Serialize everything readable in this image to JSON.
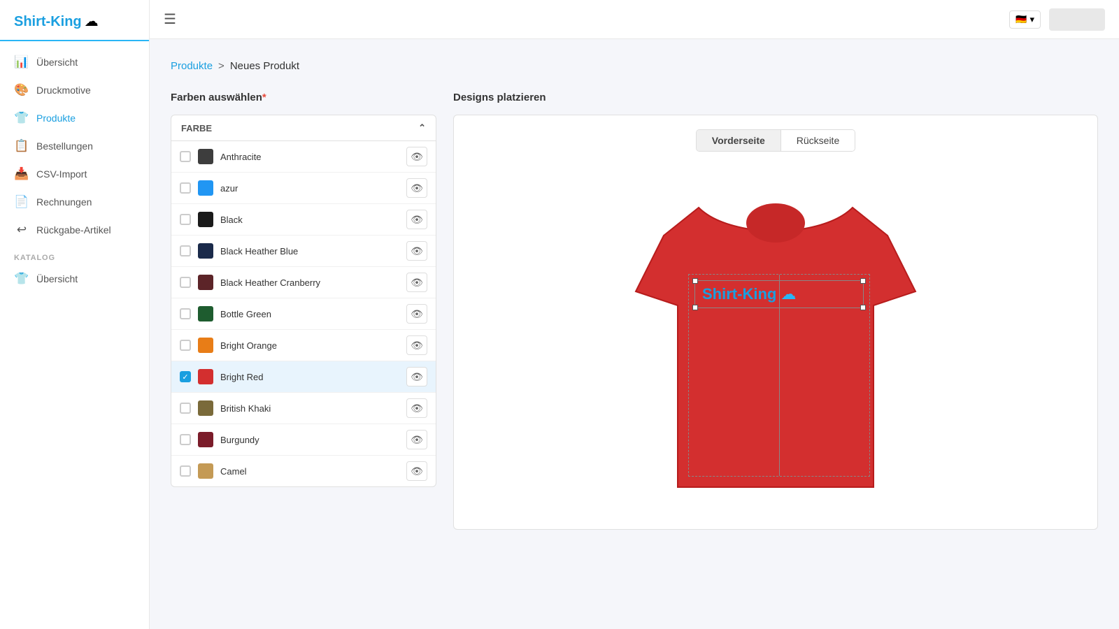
{
  "app": {
    "name": "Shirt-King",
    "logo_icon": "☁"
  },
  "topbar": {
    "hamburger": "☰",
    "flag": "🇩🇪",
    "flag_arrow": "▾"
  },
  "sidebar": {
    "nav_items": [
      {
        "id": "uebersicht",
        "label": "Übersicht",
        "icon": "📊",
        "active": false
      },
      {
        "id": "druckmotive",
        "label": "Druckmotive",
        "icon": "🎨",
        "active": false
      },
      {
        "id": "produkte",
        "label": "Produkte",
        "icon": "👕",
        "active": true
      },
      {
        "id": "bestellungen",
        "label": "Bestellungen",
        "icon": "📋",
        "active": false
      },
      {
        "id": "csv-import",
        "label": "CSV-Import",
        "icon": "📥",
        "active": false
      },
      {
        "id": "rechnungen",
        "label": "Rechnungen",
        "icon": "📄",
        "active": false
      },
      {
        "id": "rueckgabe",
        "label": "Rückgabe-Artikel",
        "icon": "↩",
        "active": false
      }
    ],
    "katalog_label": "KATALOG",
    "katalog_items": [
      {
        "id": "katalog-uebersicht",
        "label": "Übersicht",
        "icon": "👕",
        "active": false
      }
    ]
  },
  "breadcrumb": {
    "link": "Produkte",
    "arrow": ">",
    "current": "Neues Produkt"
  },
  "farben_section": {
    "title": "Farben auswählen",
    "required_marker": "*",
    "column_label": "FARBE",
    "sort_icon": "⌃"
  },
  "colors": [
    {
      "id": "anthracite",
      "name": "Anthracite",
      "swatch": "#3d3d3d",
      "selected": false
    },
    {
      "id": "azur",
      "name": "azur",
      "swatch": "#2196f3",
      "selected": false
    },
    {
      "id": "black",
      "name": "Black",
      "swatch": "#1a1a1a",
      "selected": false
    },
    {
      "id": "black-heather-blue",
      "name": "Black Heather Blue",
      "swatch": "#1a2a4a",
      "selected": false
    },
    {
      "id": "black-heather-cranberry",
      "name": "Black Heather Cranberry",
      "swatch": "#5c2428",
      "selected": false
    },
    {
      "id": "bottle-green",
      "name": "Bottle Green",
      "swatch": "#1e5c2f",
      "selected": false
    },
    {
      "id": "bright-orange",
      "name": "Bright Orange",
      "swatch": "#e87d17",
      "selected": false
    },
    {
      "id": "bright-red",
      "name": "Bright Red",
      "swatch": "#d32f2f",
      "selected": true
    },
    {
      "id": "british-khaki",
      "name": "British Khaki",
      "swatch": "#7a6a3a",
      "selected": false
    },
    {
      "id": "burgundy",
      "name": "Burgundy",
      "swatch": "#7b1c2a",
      "selected": false
    },
    {
      "id": "camel",
      "name": "Camel",
      "swatch": "#c49a55",
      "selected": false
    }
  ],
  "designs_section": {
    "title": "Designs platzieren"
  },
  "view_tabs": [
    {
      "id": "vorderseite",
      "label": "Vorderseite",
      "active": true
    },
    {
      "id": "rueckseite",
      "label": "Rückseite",
      "active": false
    }
  ],
  "tshirt": {
    "color": "#d32f2f",
    "design_text": "Shirt-King",
    "design_cloud": "☁"
  }
}
